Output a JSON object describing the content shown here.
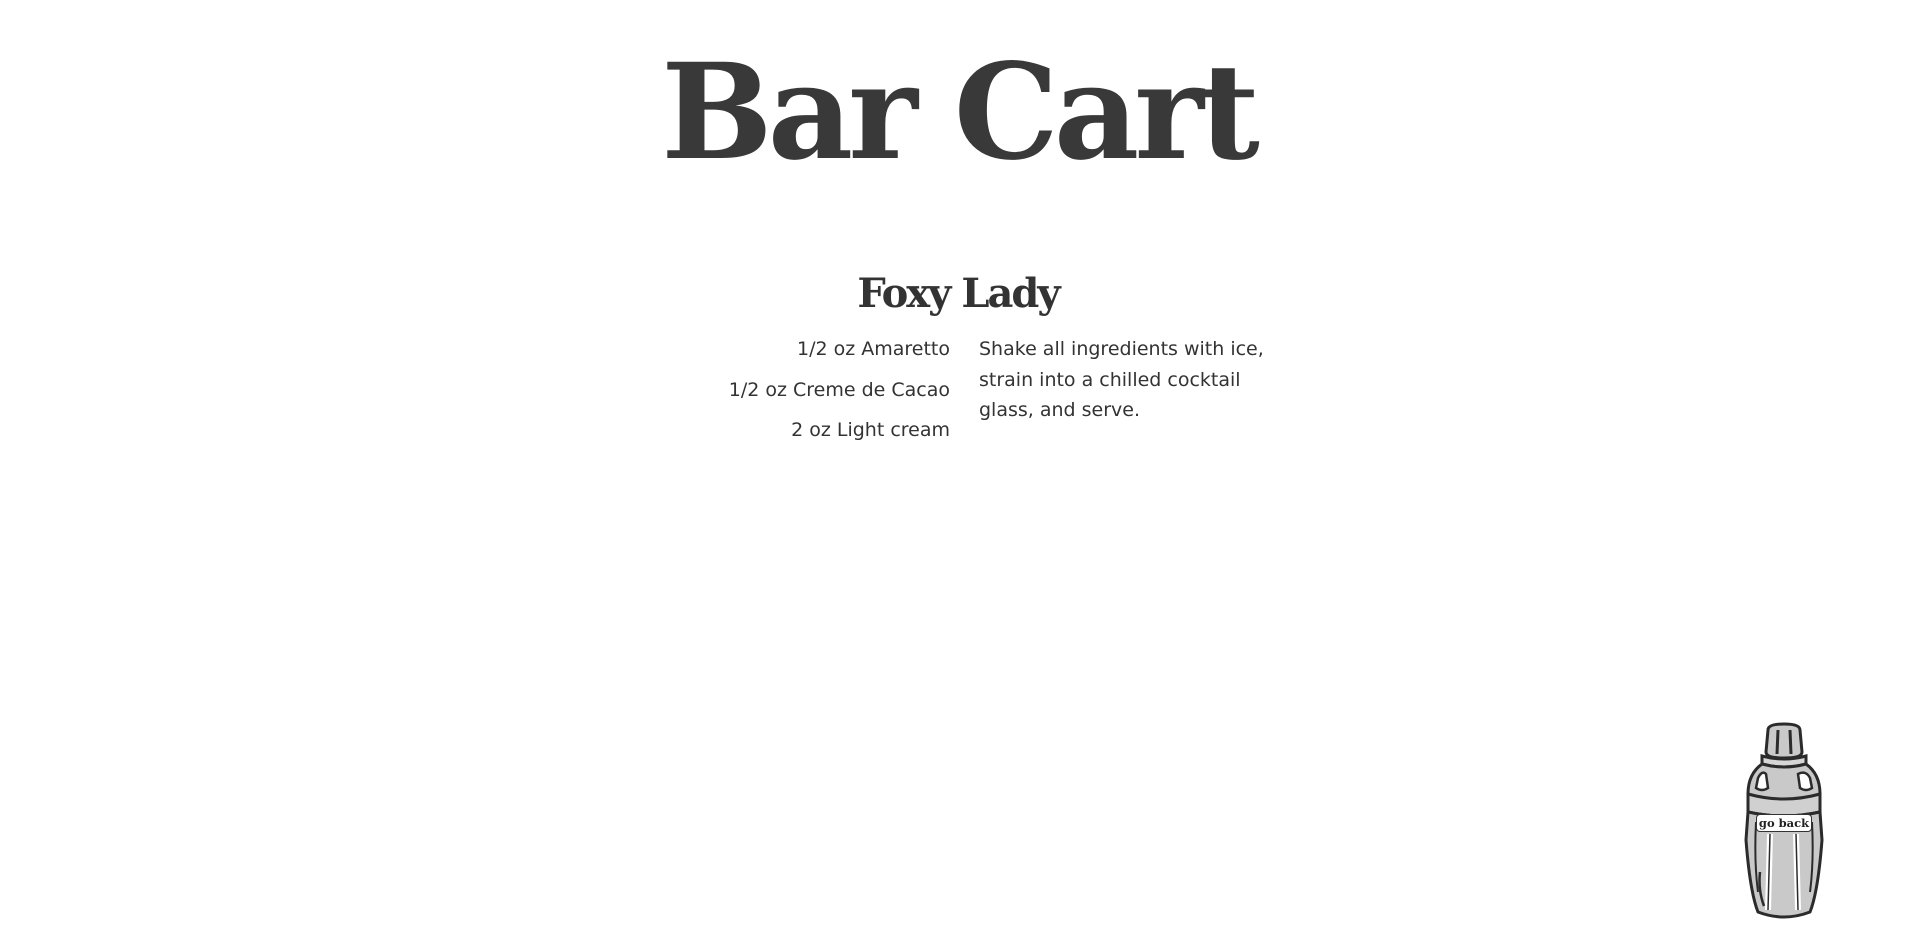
{
  "site": {
    "title": "Bar Cart"
  },
  "recipe": {
    "name": "Foxy Lady",
    "ingredients": [
      "1/2 oz Amaretto",
      "1/2 oz Creme de Cacao",
      "2 oz Light cream"
    ],
    "instructions": "Shake all ingredients with ice, strain into a chilled cocktail glass, and serve."
  },
  "nav": {
    "go_back_label": "go back",
    "go_back_icon": "cocktail-shaker-icon"
  },
  "colors": {
    "text": "#333333",
    "shaker_fill": "#c9c9c9",
    "shaker_stroke": "#2b2b2b",
    "background": "#ffffff"
  }
}
